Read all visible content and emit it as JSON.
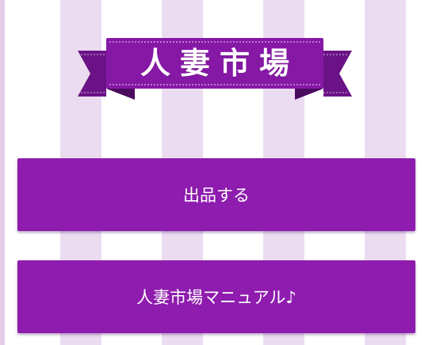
{
  "banner": {
    "title": "人妻市場"
  },
  "buttons": {
    "sell_label": "出品する",
    "manual_label": "人妻市場マニュアル♪"
  },
  "colors": {
    "primary": "#8e1cae",
    "ribbon": "#8618a6",
    "ribbon_dark": "#5e0f78",
    "stripe": "#ecdcf2"
  }
}
